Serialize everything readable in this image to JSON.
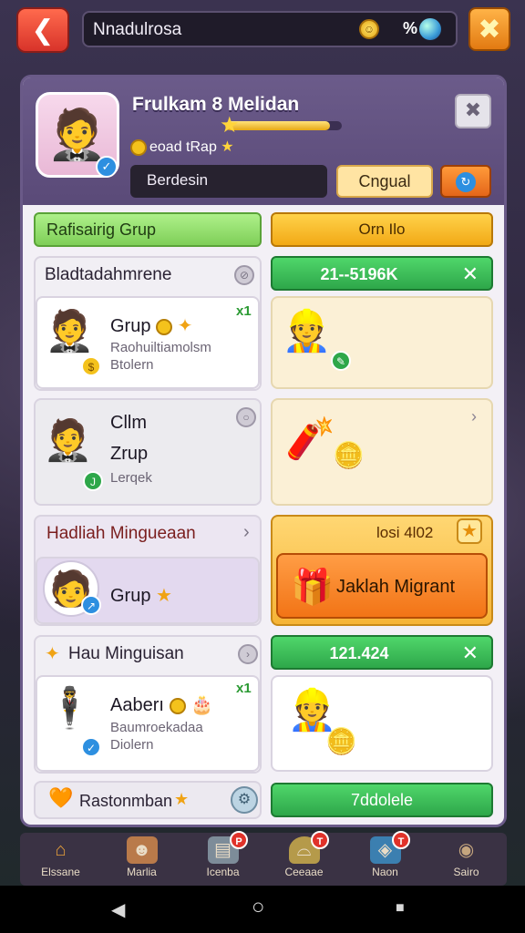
{
  "topbar": {
    "back_icon": "back-arrow-icon",
    "name_value": "Nnadulrosa",
    "coin_icon": "coin-icon",
    "percent": "%",
    "star_icon": "star-icon"
  },
  "profile": {
    "name": "Frulkam 8 Melidan",
    "xp_progress": 0.9,
    "subtitle": "eoad tRap",
    "input_value": "Berdesin",
    "grup_button": "Cngual",
    "close_icon": "close-icon"
  },
  "tabs": {
    "left": "Rafisairig Grup",
    "right": "Orn Ilo"
  },
  "sections": [
    {
      "title": "Bladtadahmrene",
      "counter": "21--5196K",
      "member": {
        "name": "Grup",
        "sub": "Raohuiltiamolsm\nBtolern",
        "rank": "x1"
      }
    },
    {
      "title": "",
      "member": {
        "name": "Cllm\nZrup",
        "sub": "Lerqek",
        "rank": ""
      }
    },
    {
      "title": "Hadliah Mingueaan",
      "counter": "losi 4l02",
      "member": {
        "name": "Grup",
        "sub": "",
        "rank": ""
      },
      "reward_button": "Jaklah Migrant"
    },
    {
      "title": "Hau Minguisan",
      "counter": "121.424",
      "member": {
        "name": "Aaberı",
        "sub": "Baumroekadaa\nDiolern",
        "rank": "x1"
      }
    },
    {
      "title": "Rastonmban",
      "action_button": "7ddolele"
    }
  ],
  "nav": [
    {
      "label": "Elssane",
      "icon": "home-icon",
      "badge": ""
    },
    {
      "label": "Marlia",
      "icon": "character-icon",
      "badge": ""
    },
    {
      "label": "Icenba",
      "icon": "chat-icon",
      "badge": "P"
    },
    {
      "label": "Ceeaae",
      "icon": "hat-icon",
      "badge": "T"
    },
    {
      "label": "Naon",
      "icon": "map-icon",
      "badge": "T"
    },
    {
      "label": "Sairo",
      "icon": "settings-icon",
      "badge": ""
    }
  ],
  "system": {
    "back": "◀",
    "home": "○",
    "recents": "■"
  }
}
